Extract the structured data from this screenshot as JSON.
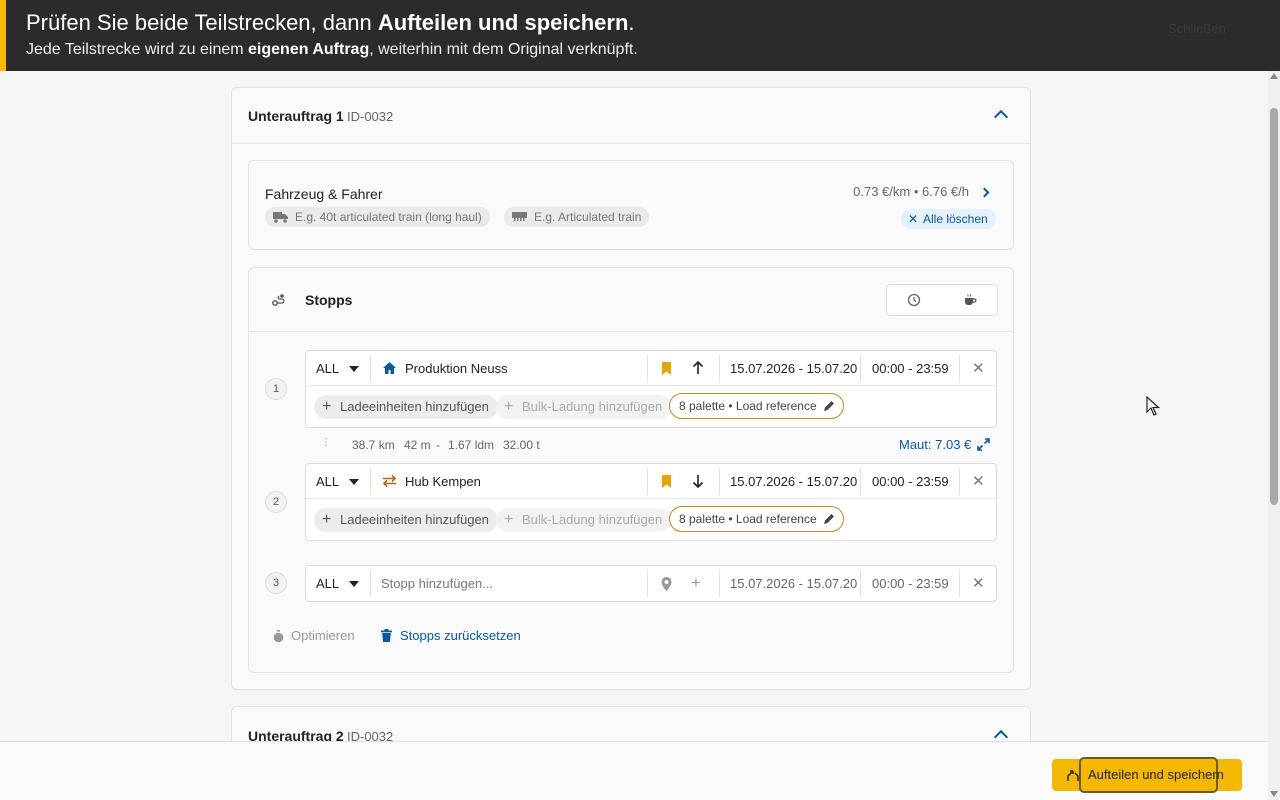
{
  "banner": {
    "line1_pre": "Prüfen Sie beide Teilstrecken, dann ",
    "line1_bold": "Aufteilen und speichern",
    "line1_post": ".",
    "line2_pre": "Jede Teilstrecke wird zu einem ",
    "line2_bold": "eigenen Auftrag",
    "line2_post": ", weiterhin mit dem Original verknüpft.",
    "close_label": "Schließen",
    "accent_color": "#f5b800"
  },
  "suborder1": {
    "title": "Unterauftrag 1",
    "id": "ID-0032",
    "vehicle": {
      "title": "Fahrzeug & Fahrer",
      "vehicle_placeholder": "E.g. 40t articulated train (long haul)",
      "trailer_placeholder": "E.g. Articulated train",
      "rate": "0.73 €/km • 6.76 €/h",
      "clear_all": "Alle löschen"
    },
    "stops": {
      "title": "Stopps",
      "items": [
        {
          "number": "1",
          "country": "ALL",
          "name": "Produktion Neuss",
          "date": "15.07.2026 - 15.07.20",
          "time": "00:00 - 23:59",
          "add_units": "Ladeeinheiten hinzufügen",
          "add_bulk": "Bulk-Ladung hinzufügen",
          "load_ref": "8 palette • Load reference"
        },
        {
          "number": "2",
          "country": "ALL",
          "name": "Hub Kempen",
          "date": "15.07.2026 - 15.07.20",
          "time": "00:00 - 23:59",
          "add_units": "Ladeeinheiten hinzufügen",
          "add_bulk": "Bulk-Ladung hinzufügen",
          "load_ref": "8 palette • Load reference"
        },
        {
          "number": "3",
          "country": "ALL",
          "placeholder": "Stopp hinzufügen...",
          "date": "15.07.2026 - 15.07.20",
          "time": "00:00 - 23:59"
        }
      ],
      "leg": {
        "distance": "38.7 km",
        "duration": "42 m",
        "sep": "-",
        "ldm": "1.67 ldm",
        "weight": "32.00 t",
        "toll": "Maut: 7.03 €"
      },
      "optimize": "Optimieren",
      "reset": "Stopps zurücksetzen"
    }
  },
  "suborder2": {
    "title": "Unterauftrag 2",
    "id": "ID-0032"
  },
  "footer": {
    "save_label": "Aufteilen und speichern"
  },
  "colors": {
    "primary_blue": "#0a5aa0",
    "accent_yellow": "#f5b800",
    "load_border": "#c48a1a"
  }
}
